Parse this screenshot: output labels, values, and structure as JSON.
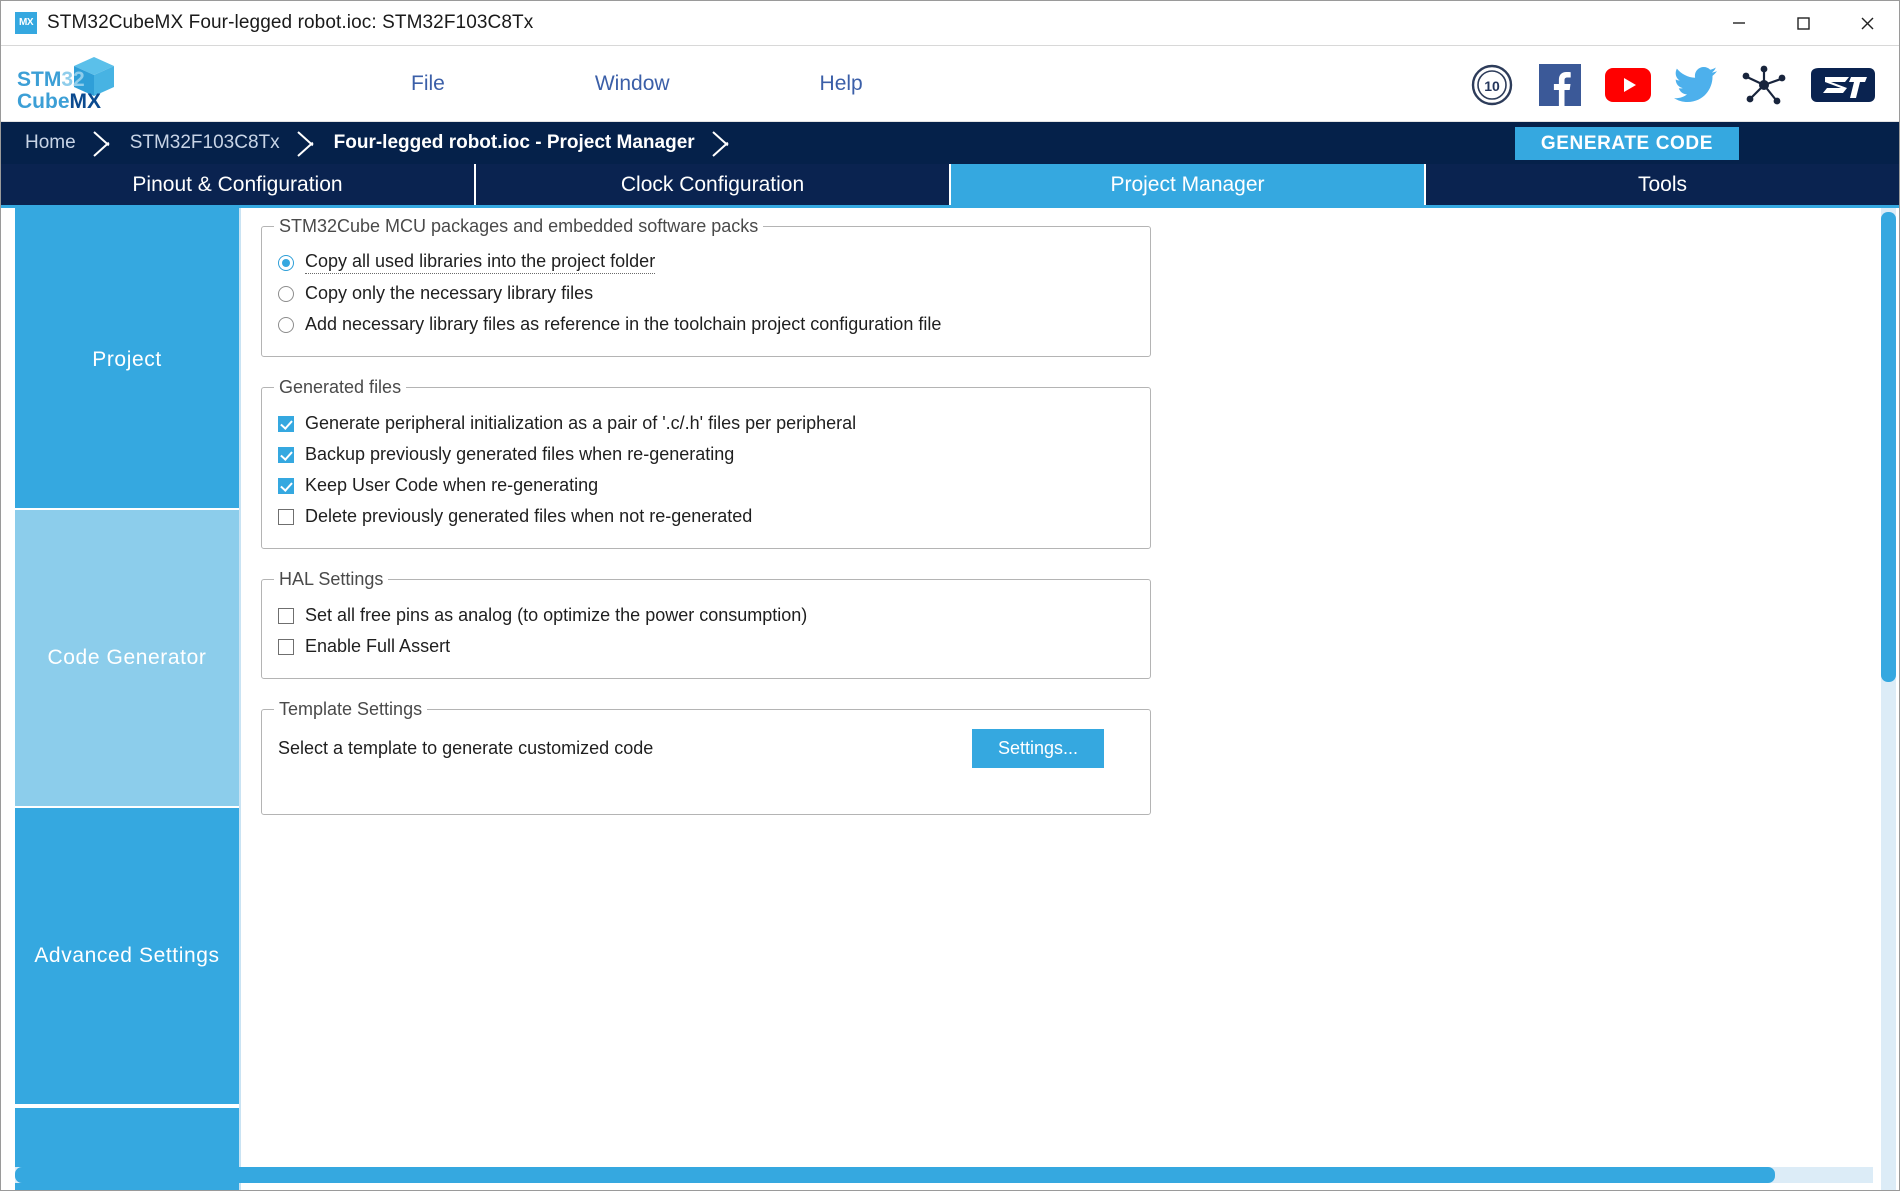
{
  "window": {
    "title": "STM32CubeMX Four-legged robot.ioc: STM32F103C8Tx",
    "app_icon": "mx-icon",
    "minimize": "—",
    "maximize": "☐",
    "close": "✕"
  },
  "brand": {
    "logo_line1_a": "STM",
    "logo_line1_b": "32",
    "logo_line2_a": "Cube",
    "logo_line2_b": "MX",
    "cube_icon": "cube-icon"
  },
  "menu": {
    "items": [
      {
        "label": "File"
      },
      {
        "label": "Window"
      },
      {
        "label": "Help"
      }
    ]
  },
  "social": {
    "icons": [
      {
        "name": "ten-years-badge-icon"
      },
      {
        "name": "facebook-icon"
      },
      {
        "name": "youtube-icon"
      },
      {
        "name": "twitter-icon"
      },
      {
        "name": "community-network-icon"
      },
      {
        "name": "st-logo-icon"
      }
    ]
  },
  "breadcrumb": {
    "items": [
      {
        "label": "Home",
        "active": false
      },
      {
        "label": "STM32F103C8Tx",
        "active": false
      },
      {
        "label": "Four-legged robot.ioc - Project Manager",
        "active": true
      }
    ],
    "generate_code_label": "GENERATE CODE"
  },
  "tabs": [
    {
      "label": "Pinout & Configuration",
      "active": false
    },
    {
      "label": "Clock Configuration",
      "active": false
    },
    {
      "label": "Project Manager",
      "active": true
    },
    {
      "label": "Tools",
      "active": false
    }
  ],
  "sidebar": {
    "items": [
      {
        "label": "Project",
        "active": false
      },
      {
        "label": "Code Generator",
        "active": true
      },
      {
        "label": "Advanced Settings",
        "active": false
      }
    ]
  },
  "content": {
    "groups": [
      {
        "title": "STM32Cube MCU packages and embedded software packs",
        "type": "radio",
        "options": [
          {
            "label": "Copy all used libraries into the project folder",
            "checked": true,
            "focused": true
          },
          {
            "label": "Copy only the necessary library files",
            "checked": false,
            "focused": false
          },
          {
            "label": "Add necessary library files as reference in the toolchain project configuration file",
            "checked": false,
            "focused": false
          }
        ]
      },
      {
        "title": "Generated files",
        "type": "checkbox",
        "options": [
          {
            "label": "Generate peripheral initialization as a pair of '.c/.h' files per peripheral",
            "checked": true,
            "focused": false
          },
          {
            "label": "Backup previously generated files when re-generating",
            "checked": true,
            "focused": false
          },
          {
            "label": "Keep User Code when re-generating",
            "checked": true,
            "focused": false
          },
          {
            "label": "Delete previously generated files when not re-generated",
            "checked": false,
            "focused": false
          }
        ]
      },
      {
        "title": "HAL Settings",
        "type": "checkbox",
        "options": [
          {
            "label": "Set all free pins as analog (to optimize the power consumption)",
            "checked": false,
            "focused": false
          },
          {
            "label": "Enable Full Assert",
            "checked": false,
            "focused": false
          }
        ]
      }
    ],
    "template_settings": {
      "title": "Template Settings",
      "description": "Select a template to generate customized code",
      "button_label": "Settings..."
    }
  },
  "scrollbars": {
    "vertical_name": "vertical-scrollbar",
    "horizontal_name": "horizontal-scrollbar"
  },
  "colors": {
    "accent": "#35a8e0",
    "dark_navy": "#05214a",
    "sidebar_active": "#8ccdeb",
    "facebook": "#3b5998",
    "youtube": "#ff0000",
    "twitter": "#4db0ec"
  }
}
